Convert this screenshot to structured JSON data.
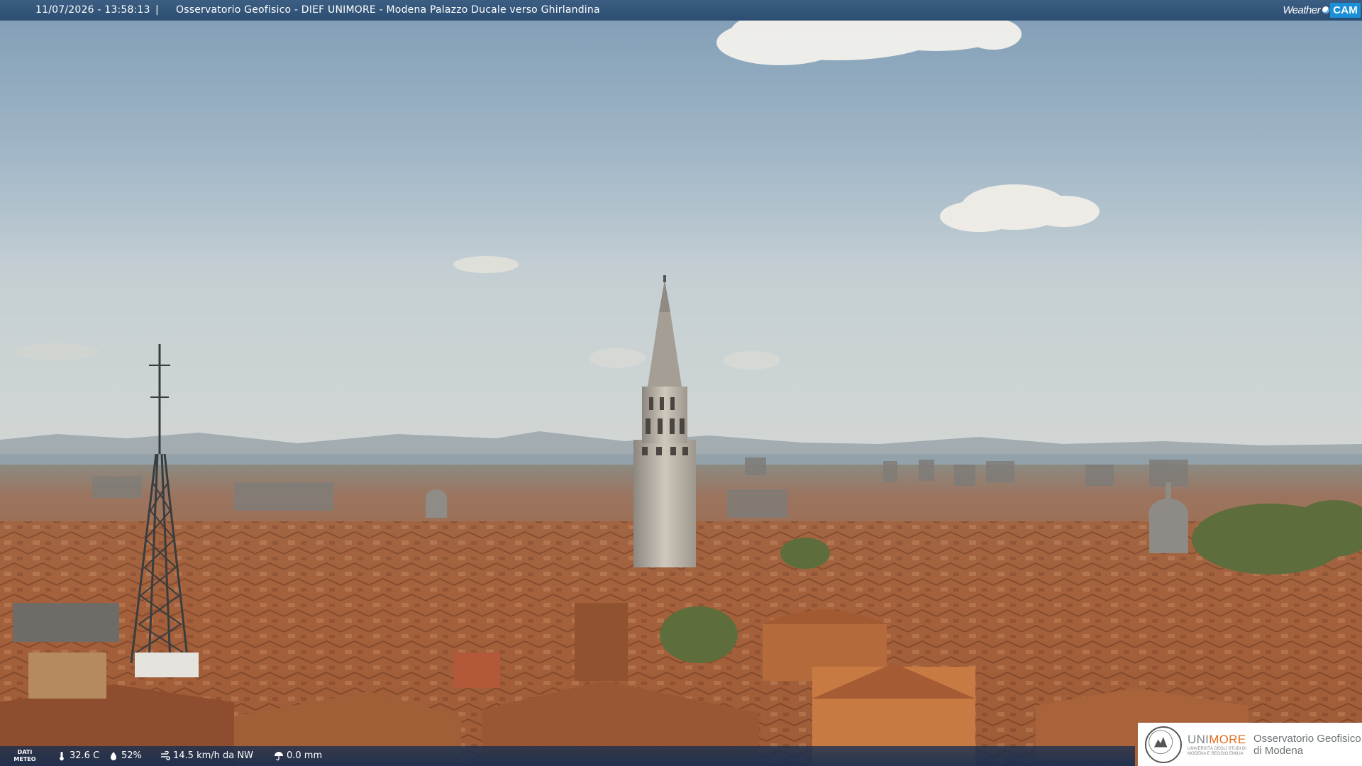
{
  "header": {
    "timestamp": "11/07/2026 - 13:58:13",
    "separator": "|",
    "title": "Osservatorio Geofisico - DIEF UNIMORE - Modena Palazzo Ducale verso Ghirlandina"
  },
  "brand": {
    "weather": "Weather",
    "cam": "CAM"
  },
  "meteo": {
    "label_line1": "DATI",
    "label_line2": "METEO",
    "temperature": "32.6 C",
    "humidity": "52%",
    "wind": "14.5 km/h da NW",
    "rain": "0.0 mm"
  },
  "footer_logo": {
    "university_prefix": "UNI",
    "university_suffix": "MORE",
    "university_sub_line1": "UNIVERSITÀ DEGLI STUDI DI",
    "university_sub_line2": "MODENA E REGGIO EMILIA",
    "observatory_line1": "Osservatorio Geofisico",
    "observatory_line2": "di Modena"
  },
  "colors": {
    "header_bg": "#2d4e73",
    "brand_cam_bg": "#1b8fd8",
    "unimore_accent": "#e36f1e",
    "sky": "#a9bccb",
    "roofs": "#a0623d"
  }
}
